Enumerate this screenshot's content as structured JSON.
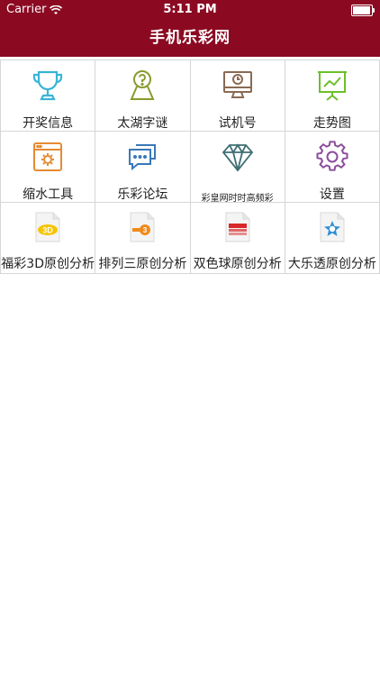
{
  "status": {
    "carrier": "Carrier",
    "time": "5:11 PM"
  },
  "header": {
    "title": "手机乐彩网",
    "bg": "#8b0a22"
  },
  "grid": [
    {
      "label": "开奖信息",
      "icon": "trophy-icon"
    },
    {
      "label": "太湖字谜",
      "icon": "person-question-icon"
    },
    {
      "label": "试机号",
      "icon": "monitor-clock-icon"
    },
    {
      "label": "走势图",
      "icon": "chart-board-icon"
    },
    {
      "label": "缩水工具",
      "icon": "browser-gear-icon"
    },
    {
      "label": "乐彩论坛",
      "icon": "chat-bubbles-icon"
    },
    {
      "label": "彩皇网时时高频彩",
      "icon": "diamond-icon"
    },
    {
      "label": "设置",
      "icon": "gear-icon"
    },
    {
      "label": "福彩3D原创分析",
      "icon": "fc3d-doc-icon"
    },
    {
      "label": "排列三原创分析",
      "icon": "pl3-doc-icon"
    },
    {
      "label": "双色球原创分析",
      "icon": "ssq-doc-icon"
    },
    {
      "label": "大乐透原创分析",
      "icon": "dlt-doc-icon"
    }
  ]
}
